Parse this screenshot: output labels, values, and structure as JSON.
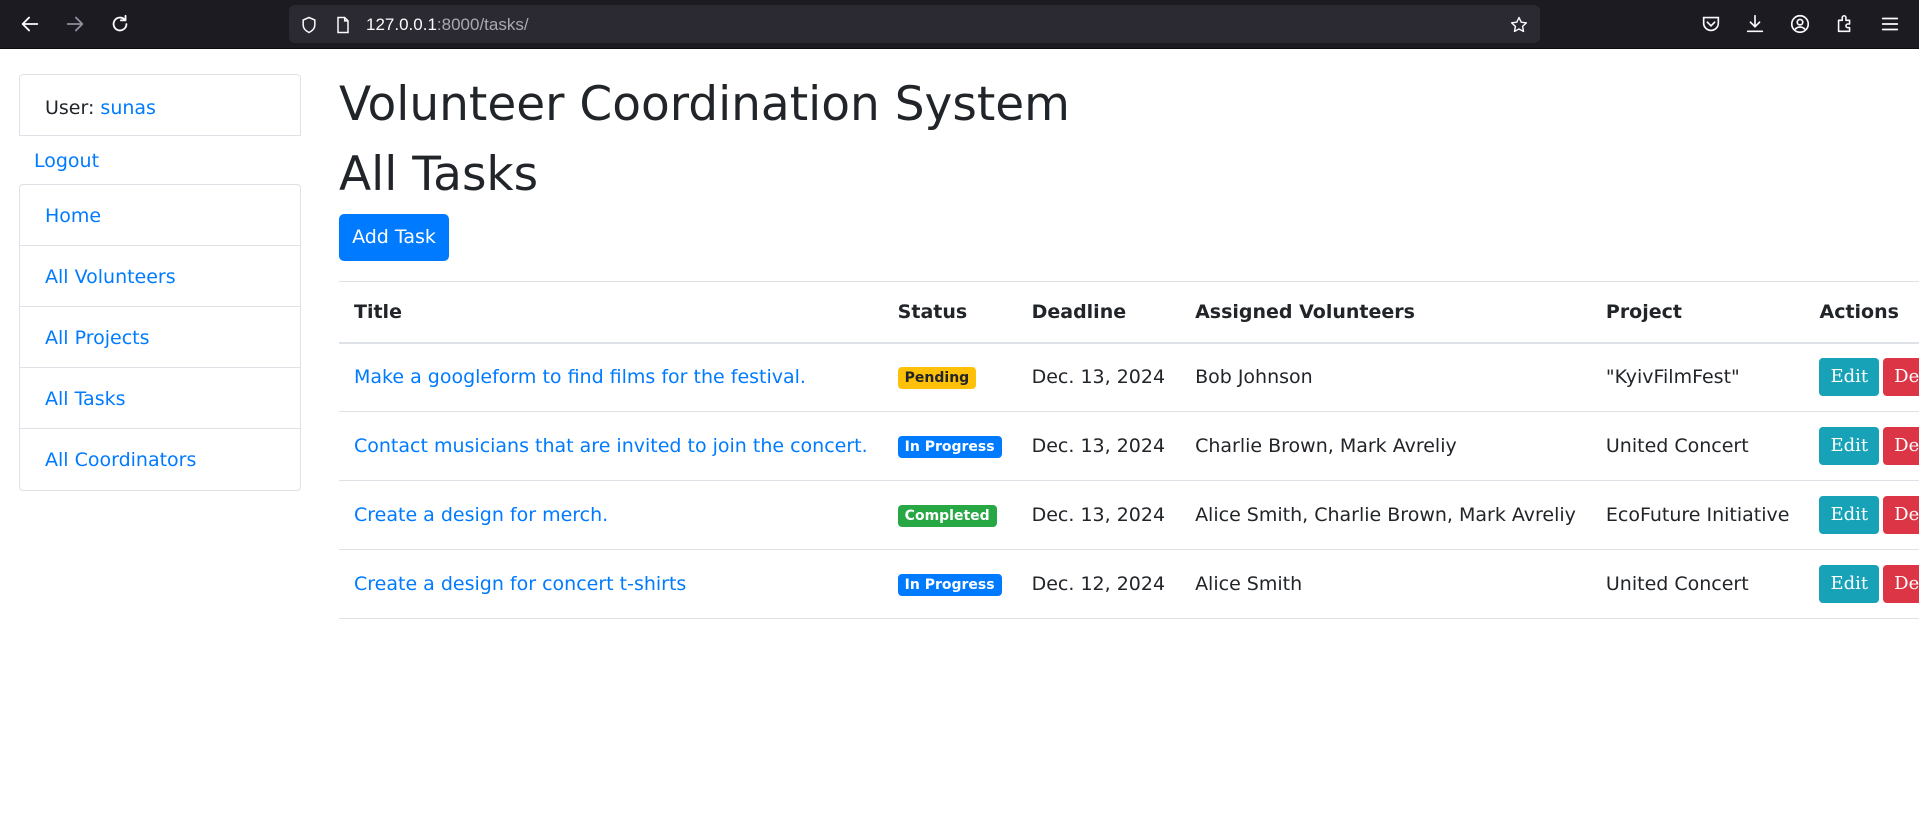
{
  "browser": {
    "url_host": "127.0.0.1",
    "url_rest": ":8000/tasks/"
  },
  "sidebar": {
    "user_label": "User: ",
    "user_name": "sunas",
    "logout": "Logout",
    "items": [
      {
        "label": "Home"
      },
      {
        "label": "All Volunteers"
      },
      {
        "label": "All Projects"
      },
      {
        "label": "All Tasks"
      },
      {
        "label": "All Coordinators"
      }
    ]
  },
  "main": {
    "app_title": "Volunteer Coordination System",
    "page_title": "All Tasks",
    "add_button": "Add Task"
  },
  "table": {
    "headers": [
      "Title",
      "Status",
      "Deadline",
      "Assigned Volunteers",
      "Project",
      "Actions"
    ],
    "rows": [
      {
        "title": "Make a googleform to find films for the festival.",
        "status": "Pending",
        "deadline": "Dec. 13, 2024",
        "volunteers": "Bob Johnson",
        "project": "\"KyivFilmFest\"",
        "edit": "Edit",
        "delete": "Delete"
      },
      {
        "title": "Contact musicians that are invited to join the concert.",
        "status": "In Progress",
        "deadline": "Dec. 13, 2024",
        "volunteers": "Charlie Brown, Mark Avreliy",
        "project": "United Concert",
        "edit": "Edit",
        "delete": "Delete"
      },
      {
        "title": "Create a design for merch.",
        "status": "Completed",
        "deadline": "Dec. 13, 2024",
        "volunteers": "Alice Smith, Charlie Brown, Mark Avreliy",
        "project": "EcoFuture Initiative",
        "edit": "Edit",
        "delete": "Delete"
      },
      {
        "title": "Create a design for concert t-shirts",
        "status": "In Progress",
        "deadline": "Dec. 12, 2024",
        "volunteers": "Alice Smith",
        "project": "United Concert",
        "edit": "Edit",
        "delete": "Delete"
      }
    ]
  },
  "colors": {
    "link": "#007bff",
    "pending": "#ffc107",
    "in_progress": "#007bff",
    "completed": "#28a745",
    "edit": "#17a2b8",
    "delete": "#dc3545"
  }
}
